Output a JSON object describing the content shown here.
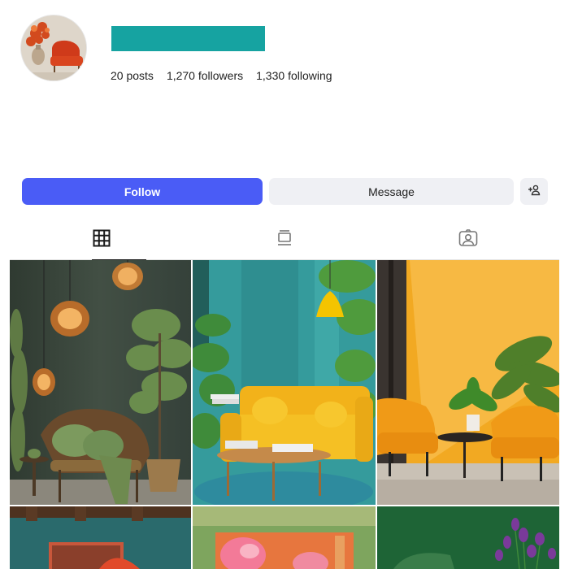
{
  "profile": {
    "username_redacted": true,
    "username_bar_color": "#16a3a1",
    "avatar_description": "profile-avatar"
  },
  "stats": {
    "posts": "20",
    "posts_label": "posts",
    "followers": "1,270",
    "followers_label": "followers",
    "following": "1,330",
    "following_label": "following"
  },
  "actions": {
    "follow_label": "Follow",
    "message_label": "Message",
    "suggest_icon": "add-person-icon",
    "follow_color": "#4a5cf6"
  },
  "tabs": [
    {
      "name": "posts",
      "icon": "grid-icon",
      "active": true
    },
    {
      "name": "reels",
      "icon": "reels-icon",
      "active": false
    },
    {
      "name": "tagged",
      "icon": "tagged-person-icon",
      "active": false
    }
  ],
  "posts": [
    {
      "name": "post-green-lounge"
    },
    {
      "name": "post-teal-yellow-sofa"
    },
    {
      "name": "post-orange-room-chairs"
    },
    {
      "name": "post-teal-art-wall"
    },
    {
      "name": "post-floral-mural"
    },
    {
      "name": "post-green-purple-flowers"
    }
  ]
}
